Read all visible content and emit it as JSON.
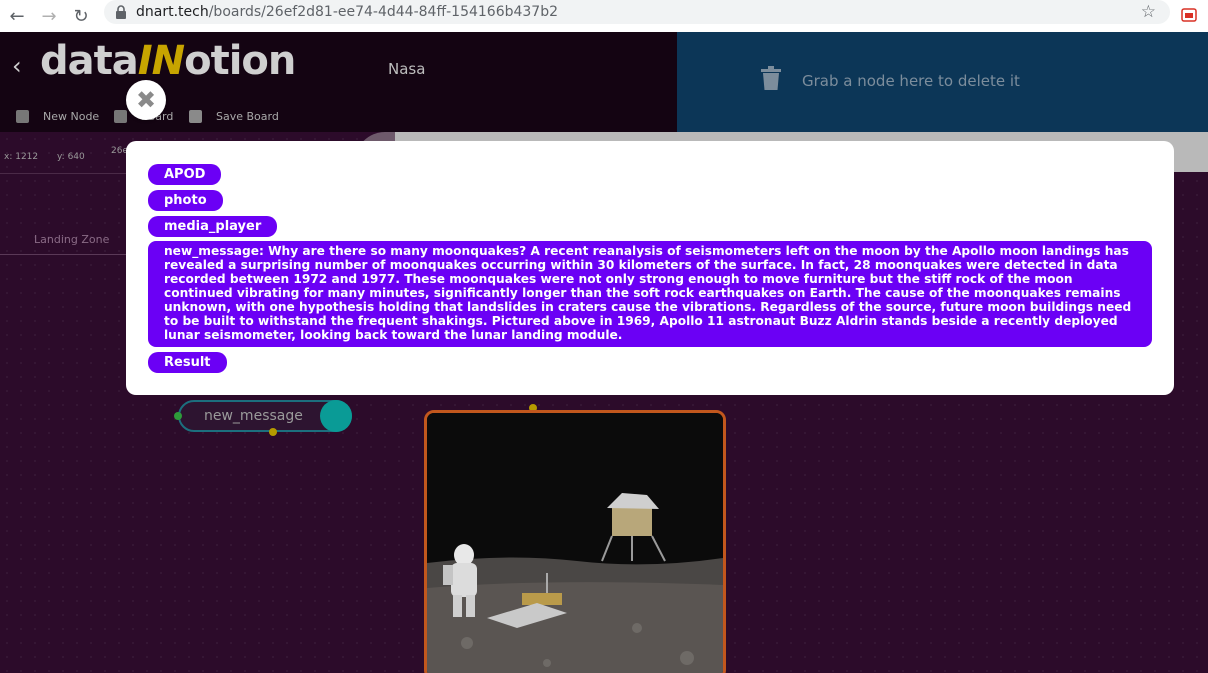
{
  "browser": {
    "url_host": "dnart.tech",
    "url_path": "/boards/26ef2d81-ee74-4d44-84ff-154166b437b2"
  },
  "app": {
    "board_title": "Nasa",
    "delete_zone_text": "Grab a node here to delete it",
    "toolbar": {
      "new_node": "New Node",
      "board": "Board",
      "save_board": "Save Board"
    },
    "coords": {
      "x": "x: 1212",
      "y": "y: 640",
      "id_fragment": "26e"
    },
    "landing_zone": "Landing Zone",
    "node_new_message": "new_message",
    "node_media_player": "media_player"
  },
  "modal": {
    "chips": [
      "APOD",
      "photo",
      "media_player"
    ],
    "message": "new_message: Why are there so many moonquakes? A recent reanalysis of seismometers left on the moon by the Apollo moon landings has revealed a surprising number of moonquakes occurring within 30 kilometers of the surface. In fact, 28 moonquakes were detected in data recorded between 1972 and 1977. These moonquakes were not only strong enough to move furniture but the stiff rock of the moon continued vibrating for many minutes, significantly longer than the soft rock earthquakes on Earth. The cause of the moonquakes remains unknown, with one hypothesis holding that landslides in craters cause the vibrations. Regardless of the source, future moon buildings need to be built to withstand the frequent shakings. Pictured above in 1969, Apollo 11 astronaut Buzz Aldrin stands beside a recently deployed lunar seismometer, looking back toward the lunar landing module.",
    "result_label": "Result"
  },
  "colors": {
    "chip_purple": "#6b00f5",
    "delete_zone": "#0c3657",
    "node_border": "#c2571d"
  }
}
